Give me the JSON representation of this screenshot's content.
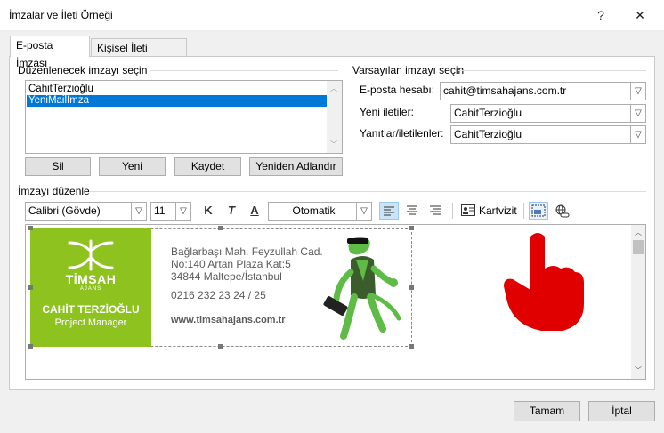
{
  "window": {
    "title": "İmzalar ve İleti Örneği",
    "help": "?",
    "close": "✕"
  },
  "tabs": [
    {
      "label": "E-posta İmzası"
    },
    {
      "label": "Kişisel İleti Örneği"
    }
  ],
  "select_section": {
    "label": "Düzenlenecek imzayı seçin",
    "items": [
      "CahitTerzioğlu",
      "YeniMailImza"
    ],
    "selected_index": 1
  },
  "buttons": {
    "delete": "Sil",
    "new": "Yeni",
    "save": "Kaydet",
    "rename": "Yeniden Adlandır",
    "ok": "Tamam",
    "cancel": "İptal"
  },
  "default_section": {
    "label": "Varsayılan imzayı seçin",
    "account_label": "E-posta hesabı:",
    "account_value": "cahit@timsahajans.com.tr",
    "new_label": "Yeni iletiler:",
    "new_value": "CahitTerzioğlu",
    "reply_label": "Yanıtlar/iletilenler:",
    "reply_value": "CahitTerzioğlu"
  },
  "edit_section": {
    "label": "İmzayı düzenle"
  },
  "toolbar": {
    "font": "Calibri (Gövde)",
    "size": "11",
    "bold": "K",
    "italic": "T",
    "underline": "A",
    "color": "Otomatik",
    "card": "Kartvizit"
  },
  "signature": {
    "logo_name": "TİMSAH",
    "logo_sub": "AJANS",
    "person": "CAHİT TERZİOĞLU",
    "role": "Project Manager",
    "address1": "Bağlarbaşı Mah. Feyzullah Cad.",
    "address2": "No:140 Artan Plaza Kat:5",
    "address3": "34844 Maltepe/İstanbul",
    "phone": "0216 232 23 24 / 25",
    "website": "www.timsahajans.com.tr"
  },
  "colors": {
    "accent": "#0078d7",
    "logo_green": "#8dc21f",
    "hand": "#e00000"
  }
}
